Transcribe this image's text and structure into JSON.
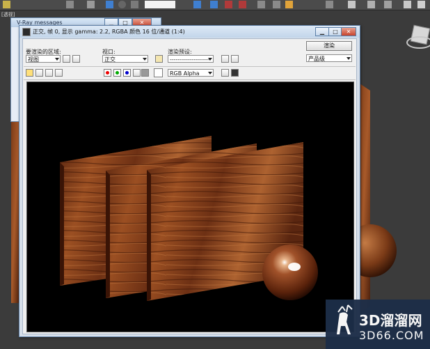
{
  "viewport": {
    "label": "[透视]"
  },
  "vray_messages": {
    "title": "V-Ray messages"
  },
  "frame_buffer": {
    "title": "正交, 帧 0, 显示 gamma: 2.2, RGBA 颜色 16 位/通道 (1:4)",
    "area_label": "要渲染的区域:",
    "area_value": "视图",
    "viewport_label": "视口:",
    "viewport_value": "正交",
    "preset_label": "渲染预设:",
    "preset_value": "--------------------",
    "render_button": "渲染",
    "quality_value": "产品级",
    "channel_value": "RGB Alpha"
  },
  "window_buttons": {
    "minimize": "▁",
    "maximize": "□",
    "close": "✕"
  },
  "watermark": {
    "brand": "3D溜溜网",
    "domain": "3D66.COM"
  },
  "colors": {
    "wood_dark": "#4a1f0c",
    "wood_mid": "#7a3a17",
    "wood_light": "#a85a2a",
    "title_blue": "#c2d5ea"
  }
}
